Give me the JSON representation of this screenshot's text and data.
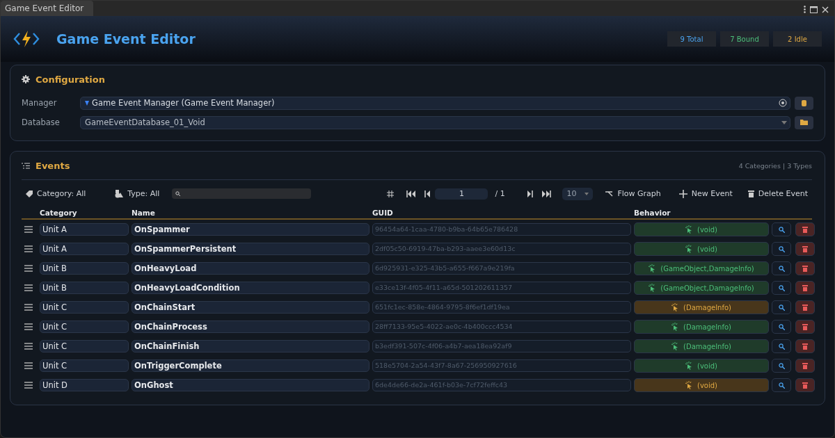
{
  "tab": {
    "title": "Game Event Editor"
  },
  "header": {
    "title": "Game Event Editor",
    "stats": [
      {
        "label": "9 Total",
        "color": "#4aa3ef"
      },
      {
        "label": "7 Bound",
        "color": "#4cbf7a"
      },
      {
        "label": "2 Idle",
        "color": "#e0a943"
      }
    ]
  },
  "configuration": {
    "title": "Configuration",
    "manager": {
      "label": "Manager",
      "value": "Game Event Manager (Game Event Manager)"
    },
    "database": {
      "label": "Database",
      "value": "GameEventDatabase_01_Void"
    }
  },
  "events": {
    "title": "Events",
    "summary": "4 Categories | 3 Types",
    "toolbar": {
      "category_filter": "Category: All",
      "type_filter": "Type: All",
      "page": "1",
      "page_total": "/ 1",
      "page_size": "10",
      "flow_graph": "Flow Graph",
      "new_event": "New Event",
      "delete_event": "Delete Event"
    },
    "columns": [
      "Category",
      "Name",
      "GUID",
      "Behavior"
    ],
    "rows": [
      {
        "category": "Unit A",
        "name": "OnSpammer",
        "guid": "96454a64-1caa-4780-b9ba-64b65e786428",
        "behavior": "(void)",
        "kind": "bound"
      },
      {
        "category": "Unit A",
        "name": "OnSpammerPersistent",
        "guid": "2df05c50-6919-47ba-b293-aaee3e60d13c",
        "behavior": "(void)",
        "kind": "bound"
      },
      {
        "category": "Unit B",
        "name": "OnHeavyLoad",
        "guid": "6d925931-e325-43b5-a655-f667a9e219fa",
        "behavior": "(GameObject,DamageInfo)",
        "kind": "bound"
      },
      {
        "category": "Unit B",
        "name": "OnHeavyLoadCondition",
        "guid": "e33ce13f-4f05-4f11-a65d-501202611357",
        "behavior": "(GameObject,DamageInfo)",
        "kind": "bound"
      },
      {
        "category": "Unit C",
        "name": "OnChainStart",
        "guid": "651fc1ec-858e-4864-9795-8f6ef1df19ea",
        "behavior": "(DamageInfo)",
        "kind": "idle"
      },
      {
        "category": "Unit C",
        "name": "OnChainProcess",
        "guid": "28ff7133-95e5-4022-ae0c-4b400ccc4534",
        "behavior": "(DamageInfo)",
        "kind": "bound"
      },
      {
        "category": "Unit C",
        "name": "OnChainFinish",
        "guid": "b3edf391-507c-4f06-a4b7-aea18ea92af9",
        "behavior": "(DamageInfo)",
        "kind": "bound"
      },
      {
        "category": "Unit C",
        "name": "OnTriggerComplete",
        "guid": "518e5704-2a54-43f7-8a67-256950927616",
        "behavior": "(void)",
        "kind": "bound"
      },
      {
        "category": "Unit D",
        "name": "OnGhost",
        "guid": "6de4de66-de2a-461f-b03e-7cf72feffc43",
        "behavior": "(void)",
        "kind": "idle"
      }
    ]
  }
}
